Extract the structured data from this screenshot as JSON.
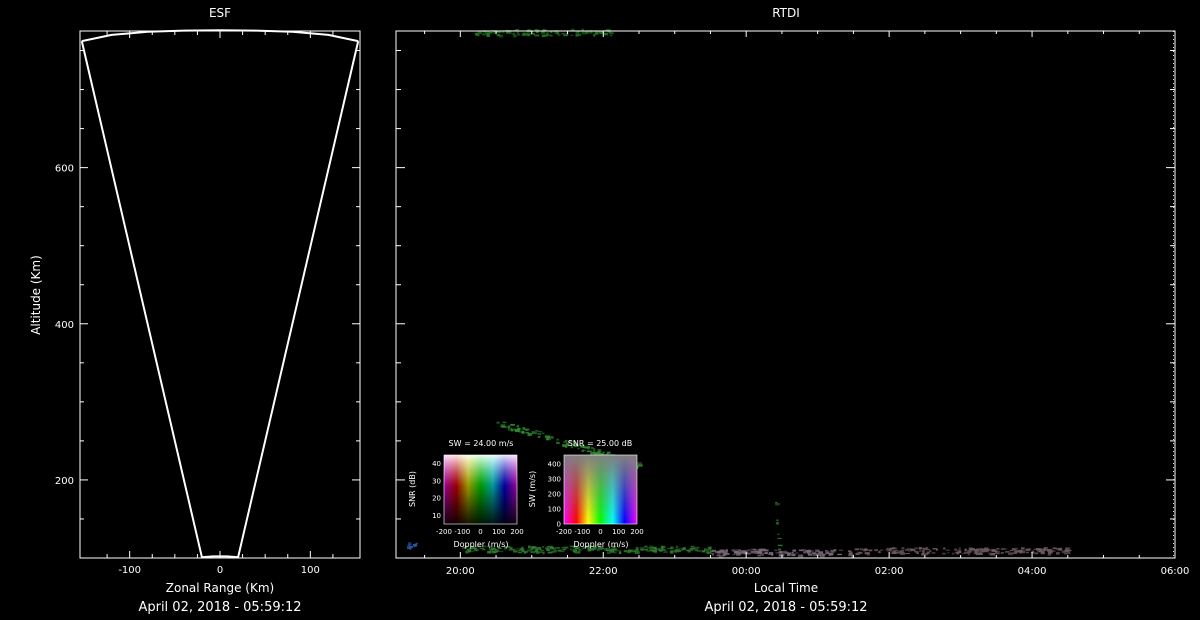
{
  "chart_data": [
    {
      "type": "line",
      "title": "ESF",
      "xlabel": "Zonal Range (Km)",
      "ylabel": "Altitude (Km)",
      "xlim": [
        -155,
        155
      ],
      "ylim": [
        100,
        775
      ],
      "xticks": [
        -100,
        0,
        100
      ],
      "yticks": [
        200,
        400,
        600
      ],
      "grid": false,
      "series": [
        {
          "values_xy": [
            [
              -153,
              762
            ],
            [
              -20,
              101
            ],
            [
              -8,
              102
            ],
            [
              8,
              102
            ],
            [
              20,
              101
            ],
            [
              153,
              762
            ]
          ]
        },
        {
          "values_xy": [
            [
              -153,
              762
            ],
            [
              -120,
              770
            ],
            [
              -80,
              774
            ],
            [
              -40,
              775.5
            ],
            [
              0,
              776
            ],
            [
              40,
              775.5
            ],
            [
              80,
              774
            ],
            [
              120,
              770
            ],
            [
              153,
              762
            ]
          ]
        }
      ],
      "footer": "April 02, 2018 - 05:59:12"
    },
    {
      "type": "scatter",
      "title": "RTDI",
      "xlabel": "Local Time",
      "ylabel": "",
      "xlim": [
        -4.9,
        6.0
      ],
      "ylim": [
        100,
        775
      ],
      "xticks": [
        -4,
        -2,
        0,
        2,
        4,
        6
      ],
      "xtick_labels": [
        "20:00",
        "22:00",
        "00:00",
        "02:00",
        "04:00",
        "06:00"
      ],
      "yticks": [
        200,
        400,
        600
      ],
      "grid": false,
      "echo_bands": [
        {
          "t0": -3.8,
          "t1": -1.9,
          "alt": 774,
          "color": "#1f6f1f"
        },
        {
          "t0": -3.5,
          "t1": -1.5,
          "alt": 275,
          "alt_end": 220,
          "color": "#2e8a2e"
        },
        {
          "t0": -4.8,
          "t1": -4.6,
          "alt": 117,
          "color": "#2a5aa8"
        },
        {
          "t0": -4.0,
          "t1": -0.5,
          "alt": 112,
          "color": "#2e7a2e"
        },
        {
          "t0": -0.5,
          "t1": 1.5,
          "alt": 108,
          "color": "#7a6a78"
        },
        {
          "t0": 1.5,
          "t1": 4.5,
          "alt": 110,
          "color": "#6e5a60"
        },
        {
          "t0": 0.4,
          "t1": 0.45,
          "alt": 180,
          "alt_end": 105,
          "color": "#2e7a2e"
        }
      ],
      "footer": "April 02, 2018 - 05:59:12"
    },
    {
      "type": "heatmap",
      "title": "SW = 24.00 m/s",
      "xlabel": "Doppler (m/s)",
      "ylabel": "SNR (dB)",
      "xtick_labels": [
        "-200",
        "-100",
        "0",
        "100",
        "200"
      ],
      "yticks": [
        10,
        20,
        30,
        40
      ]
    },
    {
      "type": "heatmap",
      "title": "SNR = 25.00 dB",
      "xlabel": "Doppler (m/s)",
      "ylabel": "SW (m/s)",
      "xtick_labels": [
        "-200",
        "-100",
        "0",
        "100",
        "200"
      ],
      "yticks": [
        0,
        100,
        200,
        300,
        400
      ]
    }
  ]
}
